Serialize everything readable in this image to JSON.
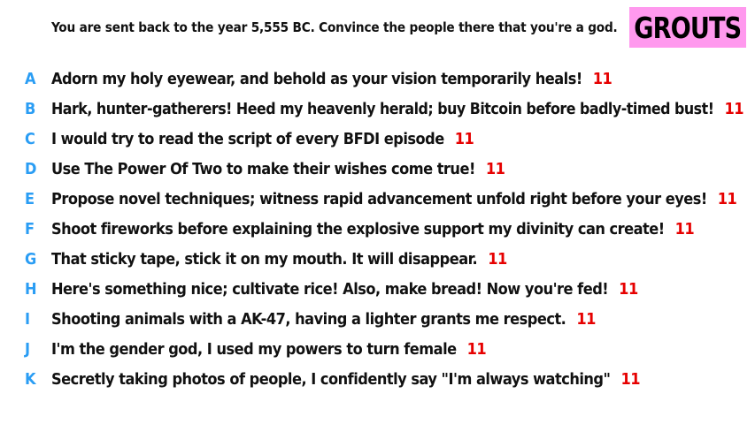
{
  "prompt": "You are sent back to the year 5,555 BC. Convince the people there that you're a god.",
  "badge": {
    "label": "GROUTS",
    "color": "#ff99ee"
  },
  "colors": {
    "letter": "#2a9df4",
    "score": "#e60000",
    "text": "#111111"
  },
  "answers": [
    {
      "letter": "A",
      "text": "Adorn my holy eyewear, and behold as your vision temporarily heals!",
      "score": "11"
    },
    {
      "letter": "B",
      "text": "Hark, hunter-gatherers! Heed my heavenly herald; buy Bitcoin before badly-timed bust!",
      "score": "11"
    },
    {
      "letter": "C",
      "text": "I would try to read the script of every BFDI episode",
      "score": "11"
    },
    {
      "letter": "D",
      "text": "Use The Power Of Two to make their wishes come true!",
      "score": "11"
    },
    {
      "letter": "E",
      "text": "Propose novel techniques; witness rapid advancement unfold right before your eyes!",
      "score": "11"
    },
    {
      "letter": "F",
      "text": "Shoot fireworks before explaining the explosive support my divinity can create!",
      "score": "11"
    },
    {
      "letter": "G",
      "text": "That sticky tape, stick it on my mouth. It will disappear.",
      "score": "11"
    },
    {
      "letter": "H",
      "text": "Here's something nice; cultivate rice! Also, make bread! Now you're fed!",
      "score": "11"
    },
    {
      "letter": "I",
      "text": "Shooting animals with a AK-47, having a lighter grants me respect.",
      "score": "11"
    },
    {
      "letter": "J",
      "text": "I'm the gender god, I used my powers to turn female",
      "score": "11"
    },
    {
      "letter": "K",
      "text": "Secretly taking photos of people, I confidently say \"I'm always watching\"",
      "score": "11"
    }
  ]
}
